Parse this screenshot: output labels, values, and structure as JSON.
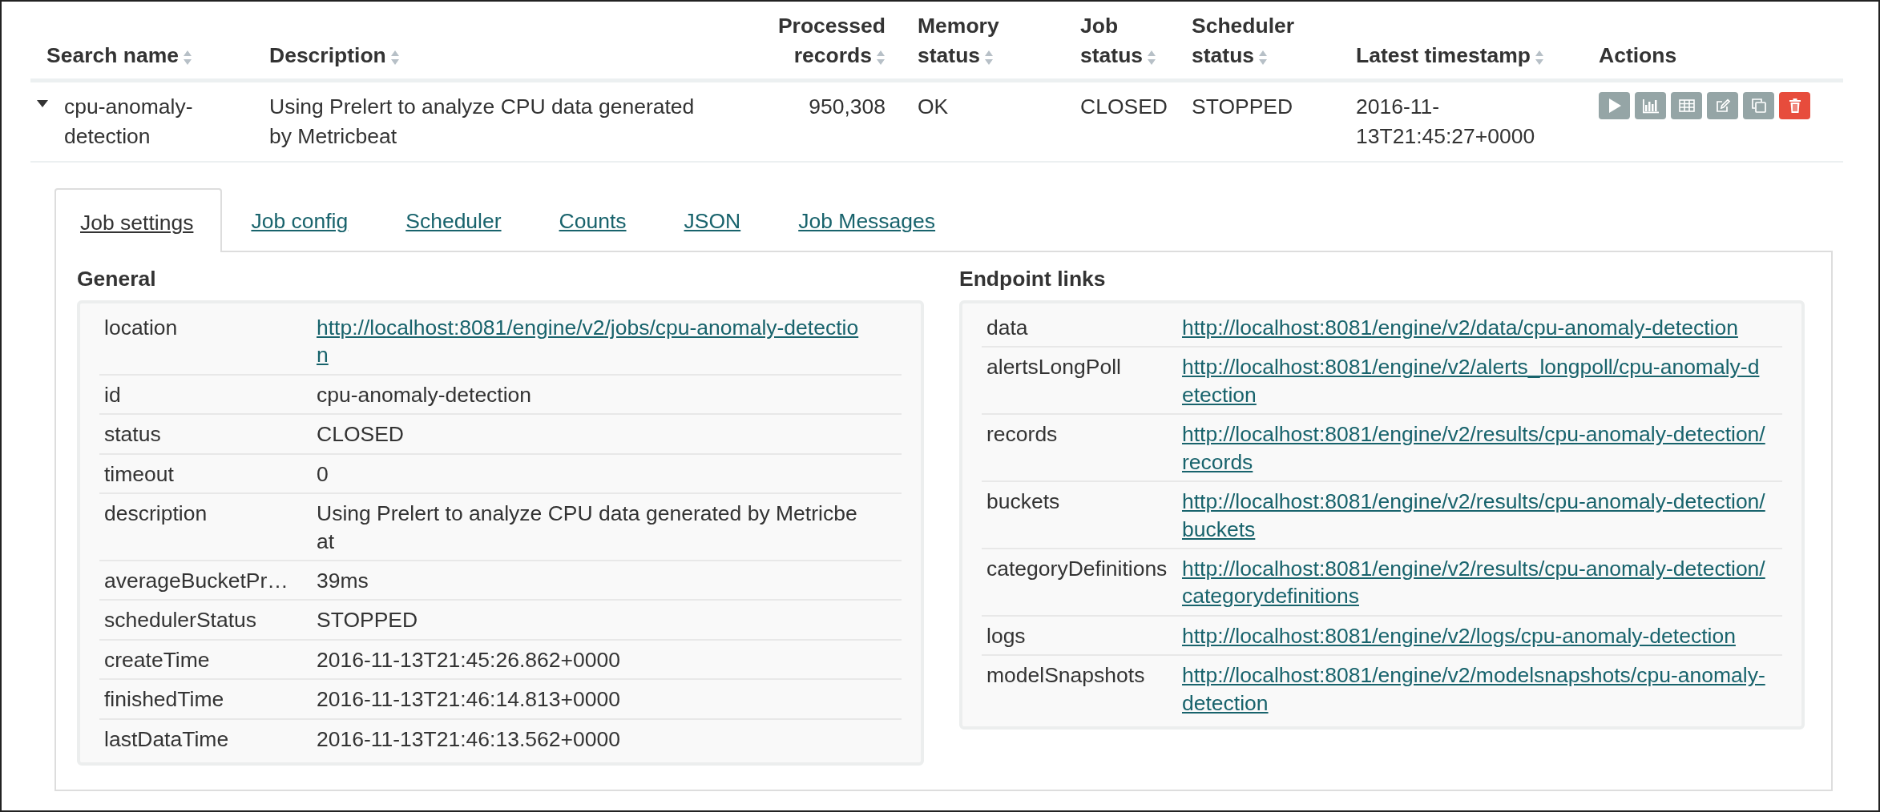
{
  "table": {
    "columns": [
      {
        "label": "Search name",
        "sortable": true,
        "numeric": false
      },
      {
        "label": "Description",
        "sortable": true,
        "numeric": false
      },
      {
        "label": "Processed records",
        "sortable": true,
        "numeric": true
      },
      {
        "label": "Memory status",
        "sortable": true,
        "numeric": false
      },
      {
        "label": "Job status",
        "sortable": true,
        "numeric": false
      },
      {
        "label": "Scheduler status",
        "sortable": true,
        "numeric": false
      },
      {
        "label": "Latest timestamp",
        "sortable": true,
        "numeric": false
      },
      {
        "label": "Actions",
        "sortable": false,
        "numeric": false
      }
    ],
    "rows": [
      {
        "expanded": true,
        "cells": [
          "cpu-anomaly-detection",
          "Using Prelert to analyze CPU data generated by Metricbeat",
          "950,308",
          "OK",
          "CLOSED",
          "STOPPED",
          "2016-11-13T21:45:27+0000"
        ],
        "actions": [
          {
            "kind": "start"
          },
          {
            "kind": "chart"
          },
          {
            "kind": "table"
          },
          {
            "kind": "edit"
          },
          {
            "kind": "clone"
          },
          {
            "kind": "delete"
          }
        ]
      }
    ]
  },
  "detail": {
    "tabs": [
      {
        "label": "Job settings",
        "selected": true
      },
      {
        "label": "Job config",
        "selected": false
      },
      {
        "label": "Scheduler",
        "selected": false
      },
      {
        "label": "Counts",
        "selected": false
      },
      {
        "label": "JSON",
        "selected": false
      },
      {
        "label": "Job Messages",
        "selected": false
      }
    ],
    "sections": [
      {
        "title": "General",
        "rows": [
          {
            "key": "location",
            "value": "http://localhost:8081/engine/v2/jobs/cpu-anomaly-detection",
            "kind": "link"
          },
          {
            "key": "id",
            "value": "cpu-anomaly-detection",
            "kind": "text"
          },
          {
            "key": "status",
            "value": "CLOSED",
            "kind": "text"
          },
          {
            "key": "timeout",
            "value": "0",
            "kind": "text"
          },
          {
            "key": "description",
            "value": "Using Prelert to analyze CPU data generated by Metricbeat",
            "kind": "text"
          },
          {
            "key": "averageBucketPr…",
            "value": "39ms",
            "kind": "text"
          },
          {
            "key": "schedulerStatus",
            "value": "STOPPED",
            "kind": "text"
          },
          {
            "key": "createTime",
            "value": "2016-11-13T21:45:26.862+0000",
            "kind": "text"
          },
          {
            "key": "finishedTime",
            "value": "2016-11-13T21:46:14.813+0000",
            "kind": "text"
          },
          {
            "key": "lastDataTime",
            "value": "2016-11-13T21:46:13.562+0000",
            "kind": "text"
          }
        ]
      },
      {
        "title": "Endpoint links",
        "rows": [
          {
            "key": "data",
            "value": "http://localhost:8081/engine/v2/data/cpu-anomaly-detection",
            "kind": "link"
          },
          {
            "key": "alertsLongPoll",
            "value": "http://localhost:8081/engine/v2/alerts_longpoll/cpu-anomaly-detection",
            "kind": "link"
          },
          {
            "key": "records",
            "value": "http://localhost:8081/engine/v2/results/cpu-anomaly-detection/records",
            "kind": "link"
          },
          {
            "key": "buckets",
            "value": "http://localhost:8081/engine/v2/results/cpu-anomaly-detection/buckets",
            "kind": "link"
          },
          {
            "key": "categoryDefinitions",
            "value": "http://localhost:8081/engine/v2/results/cpu-anomaly-detection/categorydefinitions",
            "kind": "link"
          },
          {
            "key": "logs",
            "value": "http://localhost:8081/engine/v2/logs/cpu-anomaly-detection",
            "kind": "link"
          },
          {
            "key": "modelSnapshots",
            "value": "http://localhost:8081/engine/v2/modelsnapshots/cpu-anomaly-detection",
            "kind": "link"
          }
        ]
      }
    ]
  }
}
